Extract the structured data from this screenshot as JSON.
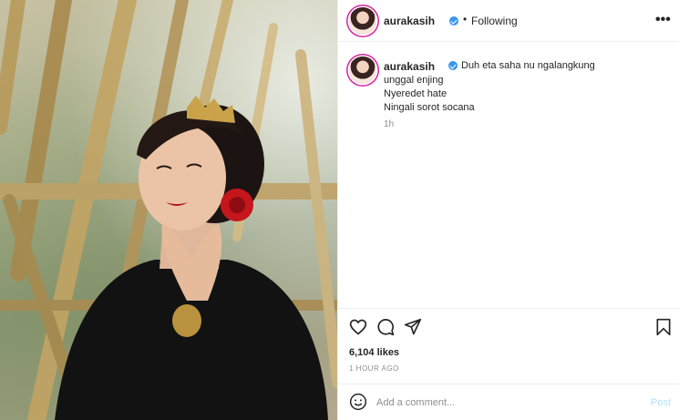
{
  "header": {
    "username": "aurakasih",
    "separator": "•",
    "follow_status": "Following",
    "more_label": "•••"
  },
  "caption": {
    "username": "aurakasih",
    "lines": [
      "Duh eta saha nu ngalangkung",
      "unggal enjing",
      "Nyeredet hate",
      "Ningali sorot socana"
    ],
    "time": "1h"
  },
  "actions": {
    "likes": "6,104 likes",
    "posted": "1 HOUR AGO"
  },
  "comment": {
    "placeholder": "Add a comment...",
    "post_label": "Post"
  },
  "icons": [
    "heart-icon",
    "comment-icon",
    "share-icon",
    "bookmark-icon",
    "emoji-icon",
    "verified-icon"
  ],
  "colors": {
    "verified": "#3897f0",
    "post_button": "#b2dffc",
    "muted": "#8e8e8e",
    "text": "#262626"
  }
}
